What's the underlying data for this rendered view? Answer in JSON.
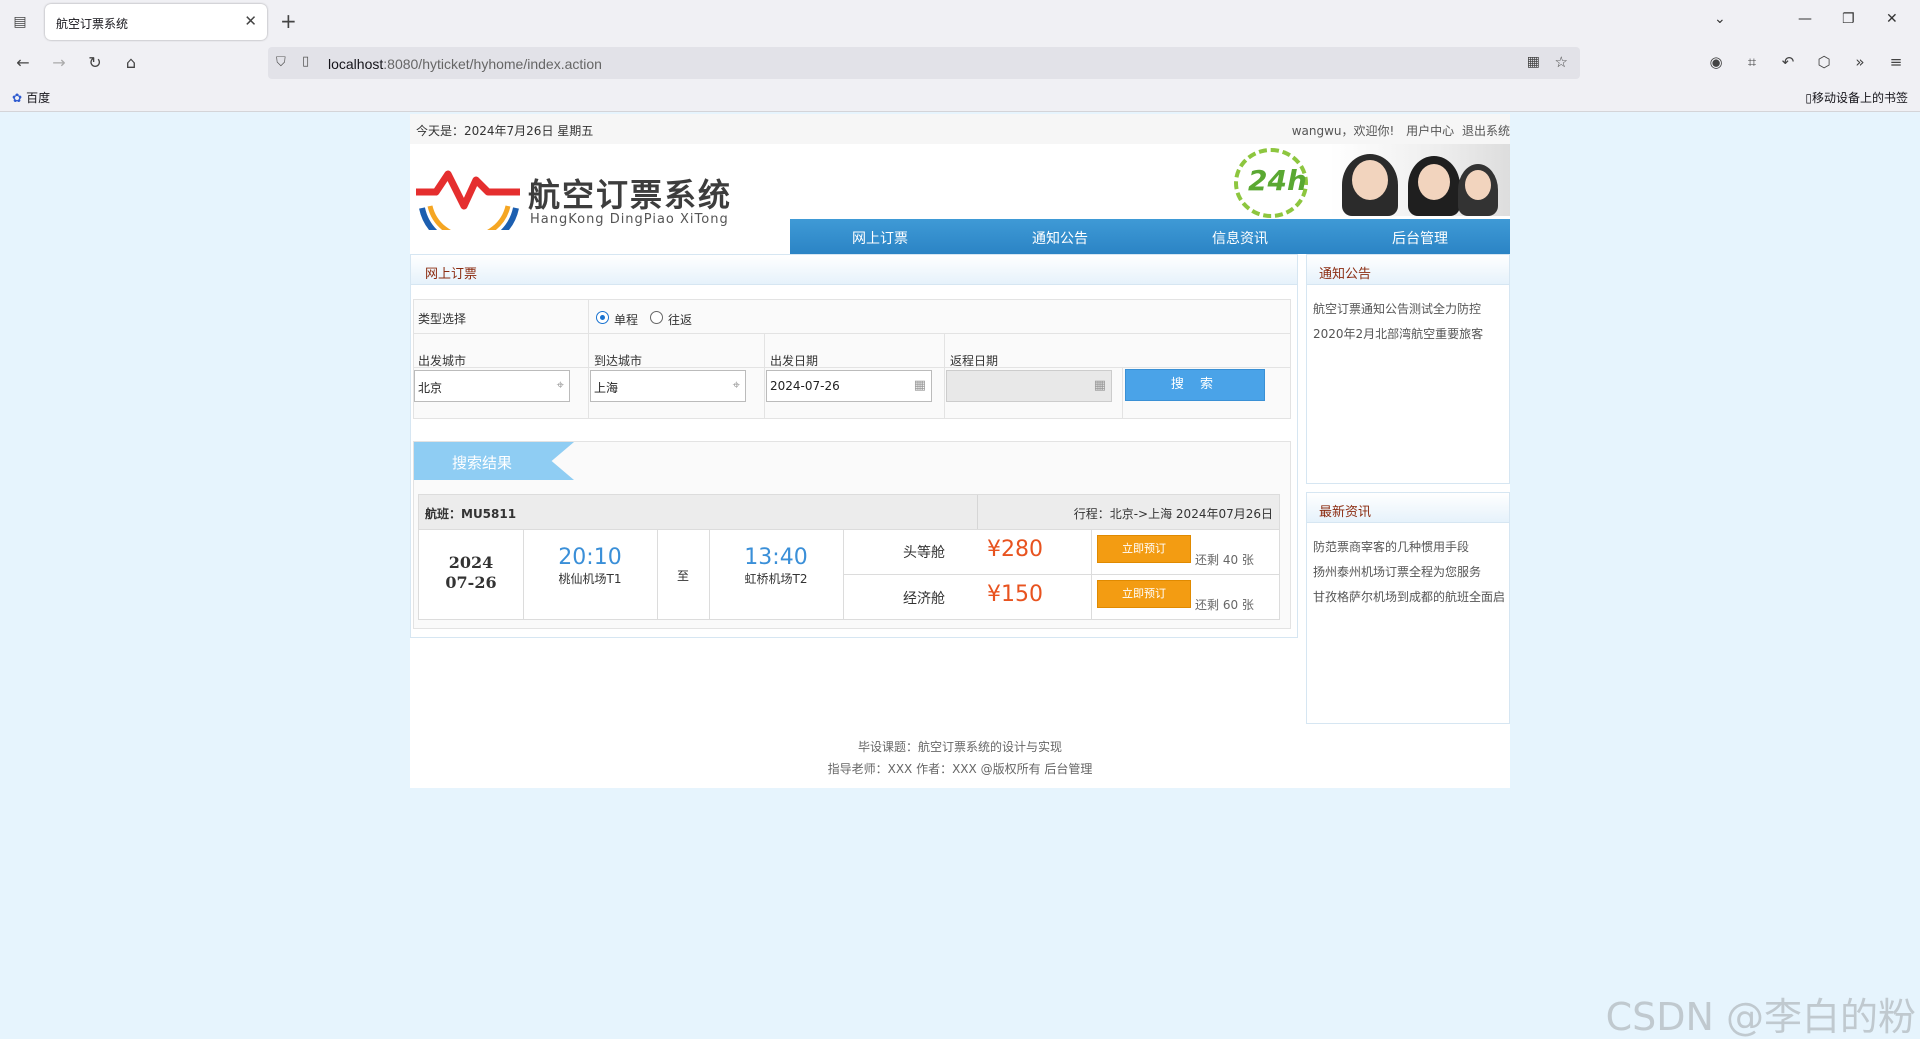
{
  "browser": {
    "tab_title": "航空订票系统",
    "url_host": "localhost",
    "url_rest": ":8080/hyticket/hyhome/index.action",
    "bookmark": "百度",
    "mobile_bookmarks": "移动设备上的书签"
  },
  "topbar": {
    "date": "今天是：2024年7月26日 星期五",
    "welcome": "wangwu，欢迎你!",
    "user_center": "用户中心",
    "logout": "退出系统"
  },
  "logo": {
    "title": "航空订票系统",
    "subtitle": "HangKong DingPiao XiTong"
  },
  "hotline": "24h",
  "nav": [
    "网上订票",
    "通知公告",
    "信息资讯",
    "后台管理"
  ],
  "booking": {
    "heading": "网上订票",
    "type_label": "类型选择",
    "one_way": "单程",
    "round_trip": "往返",
    "from_label": "出发城市",
    "to_label": "到达城市",
    "depart_label": "出发日期",
    "return_label": "返程日期",
    "from_value": "北京",
    "to_value": "上海",
    "depart_value": "2024-07-26",
    "return_value": "",
    "search_btn": "搜 索"
  },
  "results": {
    "ribbon": "搜索结果",
    "flight_no": "航班：MU5811",
    "route": "行程：北京->上海 2024年07月26日",
    "year": "2024",
    "monthday": "07-26",
    "depart_time": "20:10",
    "depart_airport": "桃仙机场T1",
    "to_word": "至",
    "arrive_time": "13:40",
    "arrive_airport": "虹桥机场T2",
    "classes": [
      {
        "name": "头等舱",
        "price": "¥280",
        "btn": "立即预订",
        "remain": "还剩 40 张"
      },
      {
        "name": "经济舱",
        "price": "¥150",
        "btn": "立即预订",
        "remain": "还剩 60 张"
      }
    ]
  },
  "notices": {
    "heading": "通知公告",
    "items": [
      "航空订票通知公告测试全力防控",
      "2020年2月北部湾航空重要旅客"
    ]
  },
  "news": {
    "heading": "最新资讯",
    "items": [
      "防范票商宰客的几种惯用手段",
      "扬州泰州机场订票全程为您服务",
      "甘孜格萨尔机场到成都的航班全面启"
    ]
  },
  "footer": {
    "line1": "毕设课题：航空订票系统的设计与实现",
    "line2": "指导老师：XXX 作者：XXX @版权所有 后台管理"
  },
  "watermark": "CSDN @李白的粉",
  "colors": {
    "nav_blue": "#2b84c5",
    "price_orange": "#e8531f",
    "book_orange": "#f39c12",
    "page_bg": "#e6f4fd"
  }
}
